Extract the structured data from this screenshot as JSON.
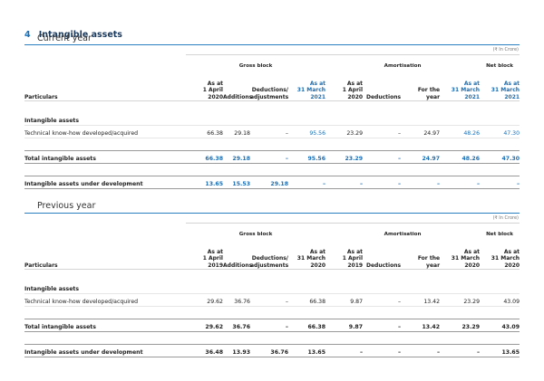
{
  "note_number": "4",
  "note_title": "Intangible assets",
  "unit_label": "(₹ In Crore)",
  "current": {
    "subtitle": "Current year",
    "groups": {
      "gross": "Gross block",
      "amort": "Amortisation",
      "net": "Net block"
    },
    "headers": {
      "particulars": "Particulars",
      "open_gross": "As at\n1 April\n2020",
      "additions": "Additions",
      "deductions_adj": "Deductions/\nadjustments",
      "close_gross": "As at\n31 March\n2021",
      "open_amort": "As at\n1 April\n2020",
      "deductions": "Deductions",
      "for_year": "For the\nyear",
      "close_amort": "As at\n31 March\n2021",
      "net": "As at\n31 March\n2021"
    },
    "section_label": "Intangible assets",
    "rows": [
      {
        "label": "Technical know-how developed/acquired",
        "cells": [
          "66.38",
          "29.18",
          "–",
          "95.56",
          "23.29",
          "–",
          "24.97",
          "48.26",
          "47.30"
        ]
      }
    ],
    "total": {
      "label": "Total intangible assets",
      "cells": [
        "66.38",
        "29.18",
        "–",
        "95.56",
        "23.29",
        "–",
        "24.97",
        "48.26",
        "47.30"
      ]
    },
    "under_dev": {
      "label": "Intangible assets under development",
      "cells": [
        "13.65",
        "15.53",
        "29.18",
        "–",
        "–",
        "–",
        "–",
        "–",
        "–"
      ]
    }
  },
  "previous": {
    "subtitle": "Previous year",
    "groups": {
      "gross": "Gross block",
      "amort": "Amortisation",
      "net": "Net block"
    },
    "headers": {
      "particulars": "Particulars",
      "open_gross": "As at\n1 April\n2019",
      "additions": "Additions",
      "deductions_adj": "Deductions/\nadjustments",
      "close_gross": "As at\n31 March\n2020",
      "open_amort": "As at\n1 April\n2019",
      "deductions": "Deductions",
      "for_year": "For the\nyear",
      "close_amort": "As at\n31 March\n2020",
      "net": "As at\n31 March\n2020"
    },
    "section_label": "Intangible assets",
    "rows": [
      {
        "label": "Technical know-how developed/acquired",
        "cells": [
          "29.62",
          "36.76",
          "–",
          "66.38",
          "9.87",
          "–",
          "13.42",
          "23.29",
          "43.09"
        ]
      }
    ],
    "total": {
      "label": "Total intangible assets",
      "cells": [
        "29.62",
        "36.76",
        "–",
        "66.38",
        "9.87",
        "–",
        "13.42",
        "23.29",
        "43.09"
      ]
    },
    "under_dev": {
      "label": "Intangible assets under development",
      "cells": [
        "36.48",
        "13.93",
        "36.76",
        "13.65",
        "–",
        "–",
        "–",
        "–",
        "13.65"
      ]
    }
  },
  "colors": {
    "accent_blue": "#1a6fb6",
    "title_navy": "#1a3a5e",
    "rule": "#2a7fc1"
  }
}
